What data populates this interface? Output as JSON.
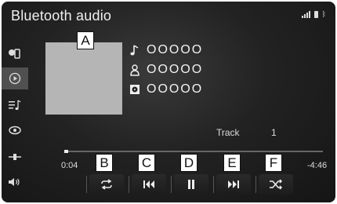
{
  "header": {
    "title": "Bluetooth audio",
    "bt_label": "ᛒ"
  },
  "sidebar": {
    "items": [
      {
        "icon": "phone-source-icon"
      },
      {
        "icon": "play-circle-icon",
        "active": true
      },
      {
        "icon": "playlist-icon"
      },
      {
        "icon": "eye-icon"
      },
      {
        "icon": "connection-icon"
      },
      {
        "icon": "volume-icon"
      }
    ]
  },
  "now_playing": {
    "song": "OOOOO",
    "artist": "OOOOO",
    "album": "OOOOO"
  },
  "track": {
    "label": "Track",
    "number": "1"
  },
  "time": {
    "elapsed": "0:04",
    "remaining": "-4:46",
    "progress": 0.015
  },
  "controls": {
    "repeat": "repeat-icon",
    "previous": "skip-back-icon",
    "pause": "pause-icon",
    "next": "skip-forward-icon",
    "shuffle": "shuffle-icon"
  },
  "callouts": {
    "a": "A",
    "b": "B",
    "c": "C",
    "d": "D",
    "e": "E",
    "f": "F"
  }
}
